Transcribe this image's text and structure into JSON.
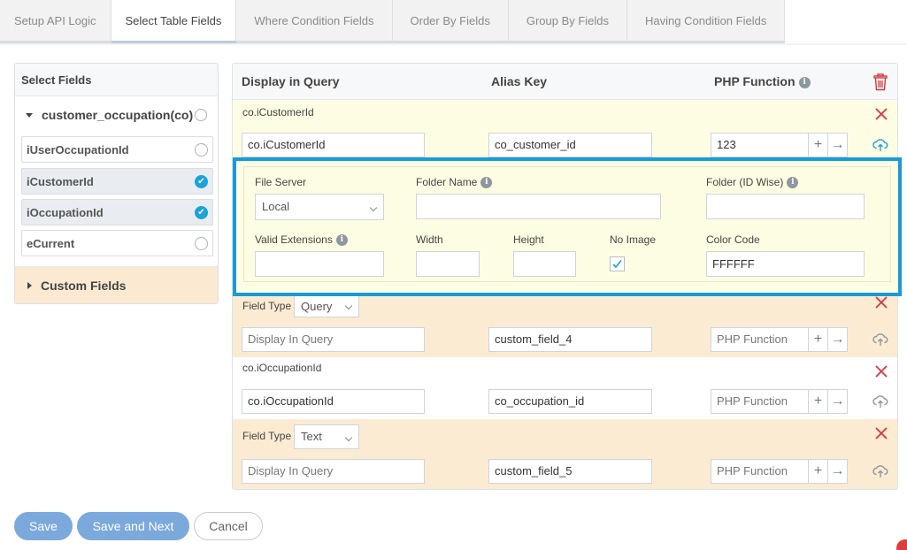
{
  "tabs": [
    {
      "label": "Setup API Logic",
      "active": false
    },
    {
      "label": "Select Table Fields",
      "active": true
    },
    {
      "label": "Where Condition Fields",
      "active": false
    },
    {
      "label": "Order By Fields",
      "active": false
    },
    {
      "label": "Group By Fields",
      "active": false
    },
    {
      "label": "Having Condition Fields",
      "active": false
    }
  ],
  "left_panel": {
    "title": "Select Fields",
    "table_name": "customer_occupation(co)",
    "fields": [
      {
        "label": "iUserOccupationId",
        "selected": false
      },
      {
        "label": "iCustomerId",
        "selected": true
      },
      {
        "label": "iOccupationId",
        "selected": true
      },
      {
        "label": "eCurrent",
        "selected": false
      }
    ],
    "custom_fields_label": "Custom Fields"
  },
  "grid": {
    "headers": {
      "display": "Display in Query",
      "alias": "Alias Key",
      "php": "PHP Function"
    },
    "rows": [
      {
        "label": "co.iCustomerId",
        "display_value": "co.iCustomerId",
        "alias_value": "co_customer_id",
        "php_value": "123"
      },
      {
        "field_type_label": "Field Type",
        "field_type_value": "Query",
        "display_placeholder": "Display In Query",
        "alias_value": "custom_field_4",
        "php_placeholder": "PHP Function"
      },
      {
        "label": "co.iOccupationId",
        "display_value": "co.iOccupationId",
        "alias_value": "co_occupation_id",
        "php_placeholder": "PHP Function"
      },
      {
        "field_type_label": "Field Type",
        "field_type_value": "Text",
        "display_placeholder": "Display In Query",
        "alias_value": "custom_field_5",
        "php_placeholder": "PHP Function"
      }
    ]
  },
  "detail": {
    "file_server_label": "File Server",
    "file_server_value": "Local",
    "folder_name_label": "Folder Name",
    "folder_id_label": "Folder (ID Wise)",
    "valid_ext_label": "Valid Extensions",
    "width_label": "Width",
    "height_label": "Height",
    "no_image_label": "No Image",
    "no_image_checked": true,
    "color_code_label": "Color Code",
    "color_code_value": "FFFFFF"
  },
  "actions": {
    "save": "Save",
    "save_next": "Save and Next",
    "cancel": "Cancel"
  },
  "colors": {
    "accent": "#1a9ad7",
    "primary_button": "#7ba9dc",
    "danger": "#d9363e"
  }
}
